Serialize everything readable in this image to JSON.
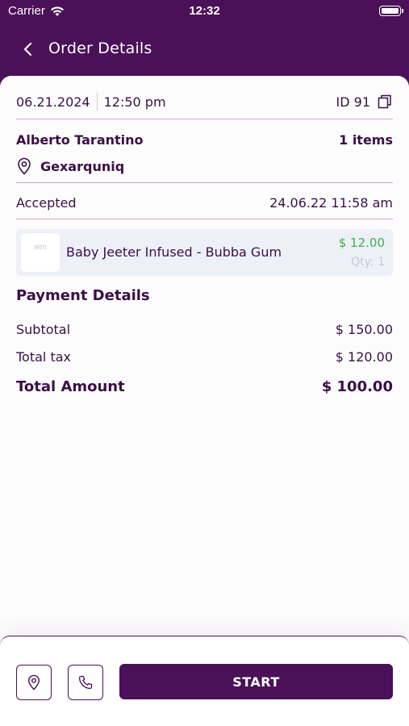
{
  "status": {
    "carrier": "Carrier",
    "time": "12:32"
  },
  "nav": {
    "title": "Order Details"
  },
  "order": {
    "date": "06.21.2024",
    "time": "12:50 pm",
    "id_label": "ID 91",
    "customer": "Alberto Tarantino",
    "items_count": "1 items",
    "location": "Gexarquniq",
    "status": "Accepted",
    "status_time": "24.06.22 11:58 am"
  },
  "items": [
    {
      "thumb_text": "wm",
      "name": "Baby Jeeter Infused - Bubba Gum",
      "price": "$ 12.00",
      "qty": "Qty: 1"
    }
  ],
  "payment": {
    "title": "Payment Details",
    "subtotal_label": "Subtotal",
    "subtotal_value": "$ 150.00",
    "tax_label": "Total tax",
    "tax_value": "$ 120.00",
    "total_label": "Total Amount",
    "total_value": "$ 100.00"
  },
  "actions": {
    "start_label": "START"
  },
  "icons": {
    "back": "chevron-left-icon",
    "copy": "copy-icon",
    "location": "location-pin-icon",
    "phone": "phone-icon",
    "wifi": "wifi-icon",
    "battery": "battery-icon"
  },
  "colors": {
    "primary": "#4a1158",
    "price": "#3cb34a",
    "separator": "#cba9d3",
    "item_bg": "#eef0f8"
  }
}
